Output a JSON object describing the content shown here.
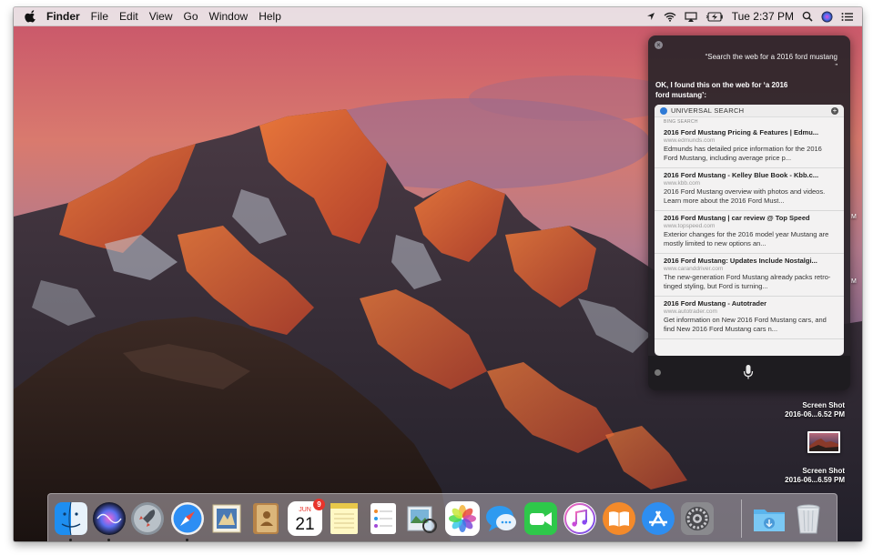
{
  "menubar": {
    "apple_icon": "apple-logo-icon",
    "app_name": "Finder",
    "items": [
      "File",
      "Edit",
      "View",
      "Go",
      "Window",
      "Help"
    ],
    "clock": "Tue 2:37 PM",
    "status_icons": [
      "location-icon",
      "wifi-icon",
      "airplay-icon",
      "battery-charging-icon",
      "spotlight-icon",
      "siri-icon",
      "notification-center-icon"
    ]
  },
  "siri": {
    "query": "“Search the web for a 2016 ford mustang ”",
    "reply": "OK, I found this on the web for ‘a 2016 ford mustang’:",
    "card": {
      "title": "UNIVERSAL SEARCH",
      "subtitle": "BING SEARCH",
      "results": [
        {
          "title": "2016 Ford Mustang Pricing & Features | Edmu...",
          "url": "www.edmunds.com",
          "desc": "Edmunds has detailed price information for the 2016 Ford Mustang, including average price p..."
        },
        {
          "title": "2016 Ford Mustang - Kelley Blue Book - Kbb.c...",
          "url": "www.kbb.com",
          "desc": "2016 Ford Mustang overview with photos and videos. Learn more about the 2016 Ford Must..."
        },
        {
          "title": "2016 Ford Mustang | car review @ Top Speed",
          "url": "www.topspeed.com",
          "desc": "Exterior changes for the 2016 model year Mustang are mostly limited to new options an..."
        },
        {
          "title": "2016 Ford Mustang: Updates Include Nostalgi...",
          "url": "www.caranddriver.com",
          "desc": "The new-generation Ford Mustang already packs retro-tinged styling, but Ford is turning..."
        },
        {
          "title": "2016 Ford Mustang - Autotrader",
          "url": "www.autotrader.com",
          "desc": "Get information on New 2016 Ford Mustang cars, and find New 2016 Ford Mustang cars n..."
        }
      ]
    }
  },
  "desktop": {
    "files": [
      {
        "line1": "Screen Shot",
        "line2": "2016-06...6.52 PM"
      },
      {
        "line1": "Screen Shot",
        "line2": "2016-06...6.59 PM"
      }
    ],
    "edge_labels": [
      "M",
      "M"
    ]
  },
  "calendar": {
    "month": "JUN",
    "day": "21",
    "badge": "9"
  },
  "dock": {
    "apps": [
      "finder-icon",
      "siri-icon",
      "launchpad-icon",
      "safari-icon",
      "mail-icon",
      "contacts-icon",
      "calendar-icon",
      "notes-icon",
      "reminders-icon",
      "preview-icon",
      "photos-icon",
      "messages-icon",
      "facetime-icon",
      "itunes-icon",
      "ibooks-icon",
      "app-store-icon",
      "system-preferences-icon",
      "downloads-folder-icon",
      "trash-icon"
    ]
  },
  "colors": {
    "siri_panel": "#262228",
    "card": "#f3f2f2",
    "accent_blue": "#2e7ad6",
    "calendar_badge": "#e8342c"
  }
}
